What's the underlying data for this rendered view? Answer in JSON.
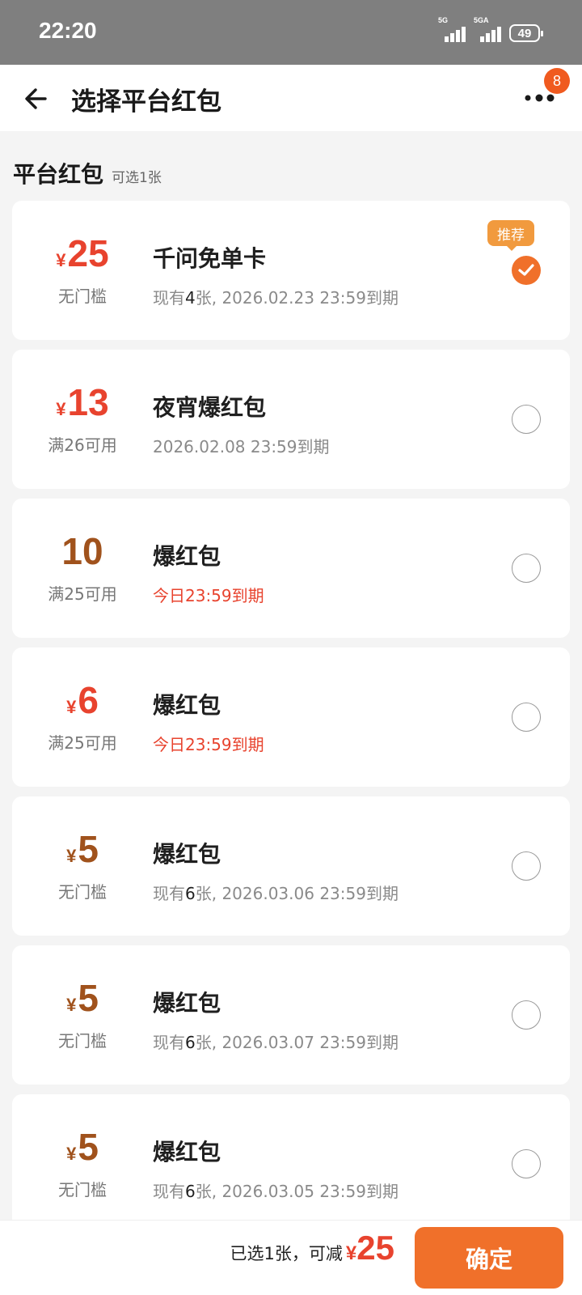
{
  "status_bar": {
    "time": "22:20",
    "signal1_label": "5G",
    "signal2_label": "5GA",
    "battery": "49"
  },
  "nav": {
    "title": "选择平台红包",
    "badge_count": "8",
    "back_icon": "arrow-left-icon",
    "more_icon": "more-dots-icon"
  },
  "section": {
    "title": "平台红包",
    "subtitle": "可选1张"
  },
  "coupons": [
    {
      "yen": "¥",
      "amount": "25",
      "color": "red",
      "condition": "无门槛",
      "name": "千问免单卡",
      "expiry_prefix": "现有",
      "expiry_count": "4",
      "expiry_suffix": "张, 2026.02.23 23:59到期",
      "urgent": false,
      "tag": "推荐",
      "selected": true
    },
    {
      "yen": "¥",
      "amount": "13",
      "color": "red",
      "condition": "满26可用",
      "name": "夜宵爆红包",
      "expiry_prefix": "",
      "expiry_count": "",
      "expiry_suffix": "2026.02.08 23:59到期",
      "urgent": false,
      "tag": "",
      "selected": false
    },
    {
      "yen": "",
      "amount": "10",
      "color": "brown",
      "condition": "满25可用",
      "name": "爆红包",
      "expiry_prefix": "",
      "expiry_count": "",
      "expiry_suffix": "今日23:59到期",
      "urgent": true,
      "tag": "",
      "selected": false
    },
    {
      "yen": "¥",
      "amount": "6",
      "color": "red",
      "condition": "满25可用",
      "name": "爆红包",
      "expiry_prefix": "",
      "expiry_count": "",
      "expiry_suffix": "今日23:59到期",
      "urgent": true,
      "tag": "",
      "selected": false
    },
    {
      "yen": "¥",
      "amount": "5",
      "color": "brown",
      "condition": "无门槛",
      "name": "爆红包",
      "expiry_prefix": "现有",
      "expiry_count": "6",
      "expiry_suffix": "张, 2026.03.06 23:59到期",
      "urgent": false,
      "tag": "",
      "selected": false
    },
    {
      "yen": "¥",
      "amount": "5",
      "color": "brown",
      "condition": "无门槛",
      "name": "爆红包",
      "expiry_prefix": "现有",
      "expiry_count": "6",
      "expiry_suffix": "张, 2026.03.07 23:59到期",
      "urgent": false,
      "tag": "",
      "selected": false
    },
    {
      "yen": "¥",
      "amount": "5",
      "color": "brown",
      "condition": "无门槛",
      "name": "爆红包",
      "expiry_prefix": "现有",
      "expiry_count": "6",
      "expiry_suffix": "张, 2026.03.05 23:59到期",
      "urgent": false,
      "tag": "",
      "selected": false
    }
  ],
  "bottom_bar": {
    "summary_text": "已选1张，可减",
    "summary_yen": "¥",
    "summary_amount": "25",
    "confirm_label": "确定"
  },
  "colors": {
    "accent": "#f0702a",
    "price_red": "#e8432e",
    "price_brown": "#a0521c",
    "tag": "#f19a3e"
  }
}
